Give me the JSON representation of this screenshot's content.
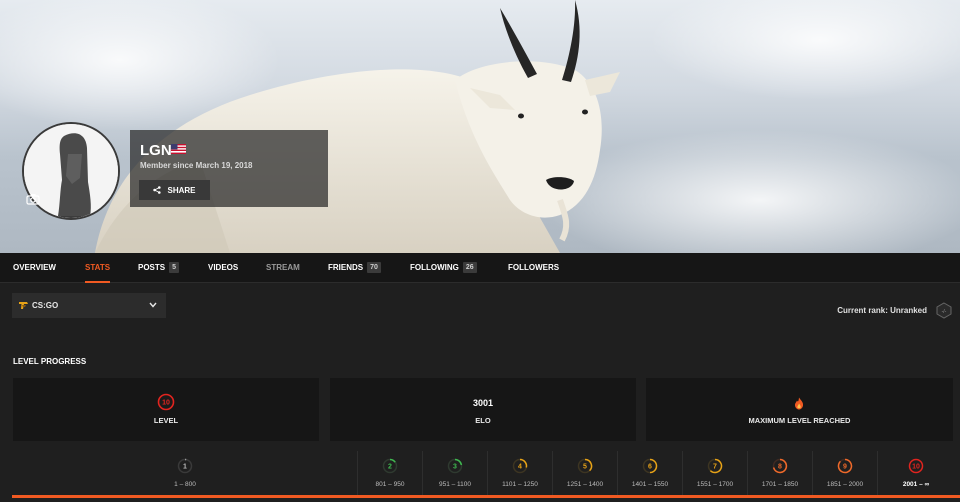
{
  "profile": {
    "username": "LGN",
    "country_flag": "us-flag",
    "member_since": "Member since March 19, 2018",
    "share_label": "SHARE"
  },
  "tabs": [
    {
      "label": "OVERVIEW",
      "count": ""
    },
    {
      "label": "STATS",
      "count": "",
      "active": true
    },
    {
      "label": "POSTS",
      "count": "5"
    },
    {
      "label": "VIDEOS",
      "count": ""
    },
    {
      "label": "STREAM",
      "count": ""
    },
    {
      "label": "FRIENDS",
      "count": "70"
    },
    {
      "label": "FOLLOWING",
      "count": "26"
    },
    {
      "label": "FOLLOWERS",
      "count": ""
    }
  ],
  "game_select": {
    "value": "CS:GO",
    "icon": "csgo-icon"
  },
  "current_rank": "Current rank: Unranked",
  "section_title": "LEVEL PROGRESS",
  "cards": {
    "level": {
      "badge": "10",
      "label": "LEVEL"
    },
    "elo": {
      "value": "3001",
      "label": "ELO"
    },
    "max": {
      "icon": "flame-icon",
      "label": "MAXIMUM LEVEL REACHED"
    }
  },
  "levels": [
    {
      "level": "1",
      "range": "1 – 800"
    },
    {
      "level": "2",
      "range": "801 – 950"
    },
    {
      "level": "3",
      "range": "951 – 1100"
    },
    {
      "level": "4",
      "range": "1101 – 1250"
    },
    {
      "level": "5",
      "range": "1251 – 1400"
    },
    {
      "level": "6",
      "range": "1401 – 1550"
    },
    {
      "level": "7",
      "range": "1551 – 1700"
    },
    {
      "level": "8",
      "range": "1701 – 1850"
    },
    {
      "level": "9",
      "range": "1851 – 2000"
    },
    {
      "level": "10",
      "range": "2001 – ∞",
      "current": true
    }
  ],
  "colors": {
    "accent": "#f15a22",
    "level_1": "#9a9a9a",
    "level_2_3": "#3fb950",
    "level_4_7": "#e8a317",
    "level_8_9": "#f06a2a",
    "level_10": "#e2241f"
  }
}
